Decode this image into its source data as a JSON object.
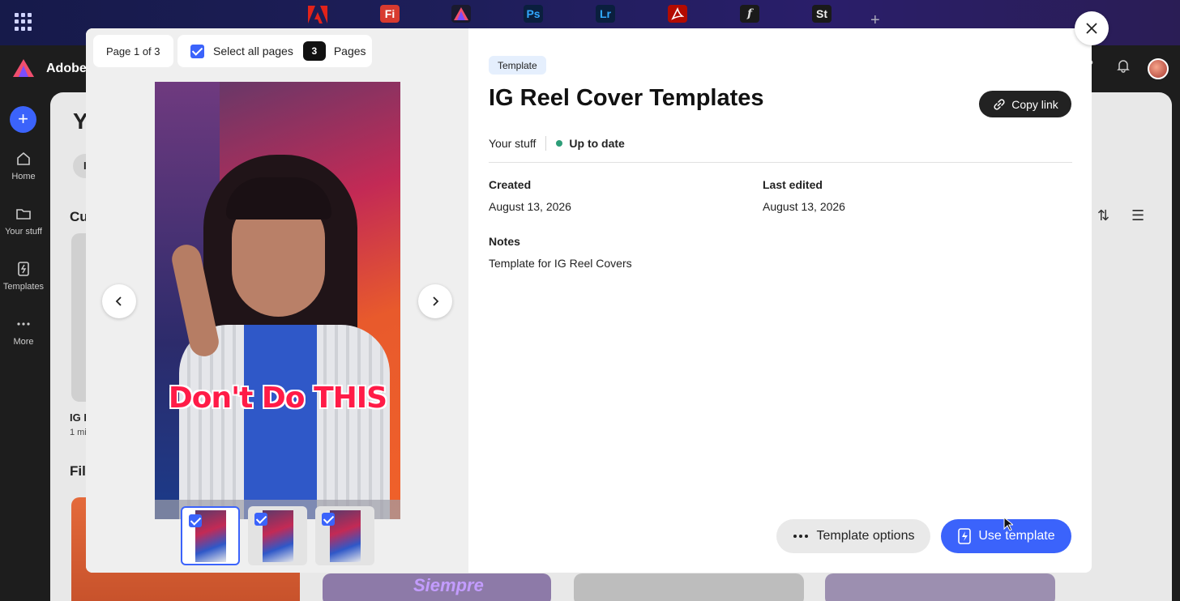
{
  "dock": {
    "apps": [
      {
        "name": "Adobe Express",
        "short": ""
      },
      {
        "name": "Fresco",
        "short": "Fi"
      },
      {
        "name": "Express",
        "short": ""
      },
      {
        "name": "Photoshop",
        "short": "Ps"
      },
      {
        "name": "Lightroom",
        "short": "Lr"
      },
      {
        "name": "Acrobat",
        "short": ""
      },
      {
        "name": "Fonts",
        "short": "f"
      },
      {
        "name": "Stock",
        "short": "St"
      }
    ],
    "add_label": "+"
  },
  "background": {
    "brand": "Adobe",
    "nav": {
      "home": "Home",
      "your_stuff": "Your stuff",
      "templates": "Templates",
      "more": "More"
    },
    "heading": "Y",
    "chip": "I",
    "section1": "Cu",
    "section2": "Fil",
    "card_title": "IG I",
    "card_sub": "1 mi",
    "card_text": "Siempre"
  },
  "preview": {
    "page_label": "Page 1 of 3",
    "select_all_label": "Select all pages",
    "page_count": "3",
    "pages_label": "Pages",
    "caption": "Don't Do THIS"
  },
  "details": {
    "tag": "Template",
    "title": "IG Reel Cover Templates",
    "copy_link": "Copy link",
    "location": "Your stuff",
    "status": "Up to date",
    "created_label": "Created",
    "created_value": "August 13, 2026",
    "edited_label": "Last edited",
    "edited_value": "August 13, 2026",
    "notes_label": "Notes",
    "notes_value": "Template for IG Reel Covers",
    "options_label": "Template options",
    "use_label": "Use template"
  },
  "colors": {
    "accent": "#3b63fb",
    "status_dot": "#2d9d78"
  }
}
